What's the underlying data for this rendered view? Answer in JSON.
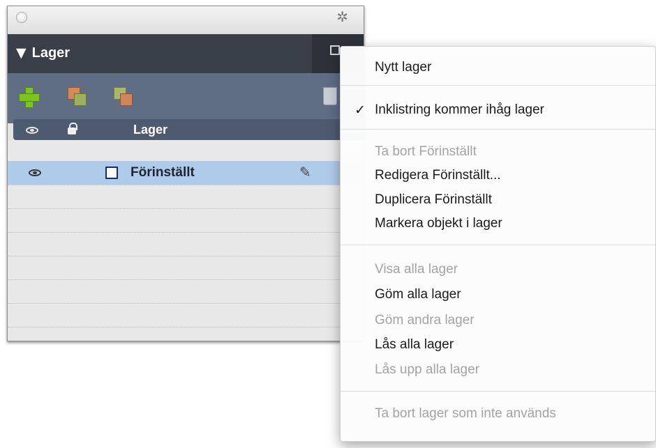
{
  "panel": {
    "title": "Lager",
    "collapse_glyph": "▼",
    "gear_glyph": "✲",
    "column_header": "Lager",
    "layer_name": "Förinställt",
    "pencil_glyph": "✎"
  },
  "menu": {
    "check_glyph": "✓",
    "items": [
      {
        "label": "Nytt lager",
        "enabled": true
      },
      {
        "label": "Inklistring kommer ihåg lager",
        "enabled": true,
        "checked": true
      },
      {
        "label": "Ta bort Förinställt",
        "enabled": false
      },
      {
        "label": "Redigera Förinställt...",
        "enabled": true
      },
      {
        "label": "Duplicera Förinställt",
        "enabled": true
      },
      {
        "label": "Markera objekt i lager",
        "enabled": true
      },
      {
        "label": "Visa alla lager",
        "enabled": false
      },
      {
        "label": "Göm alla lager",
        "enabled": true
      },
      {
        "label": "Göm andra lager",
        "enabled": false
      },
      {
        "label": "Lås alla lager",
        "enabled": true
      },
      {
        "label": "Lås upp alla lager",
        "enabled": false
      },
      {
        "label": "Ta bort lager som inte används",
        "enabled": false
      }
    ]
  },
  "colors": {
    "header": "#3a4049",
    "toolbar": "#5f6d85",
    "selected_row": "#aecbea",
    "layer_swatch": "#1b2a72"
  }
}
